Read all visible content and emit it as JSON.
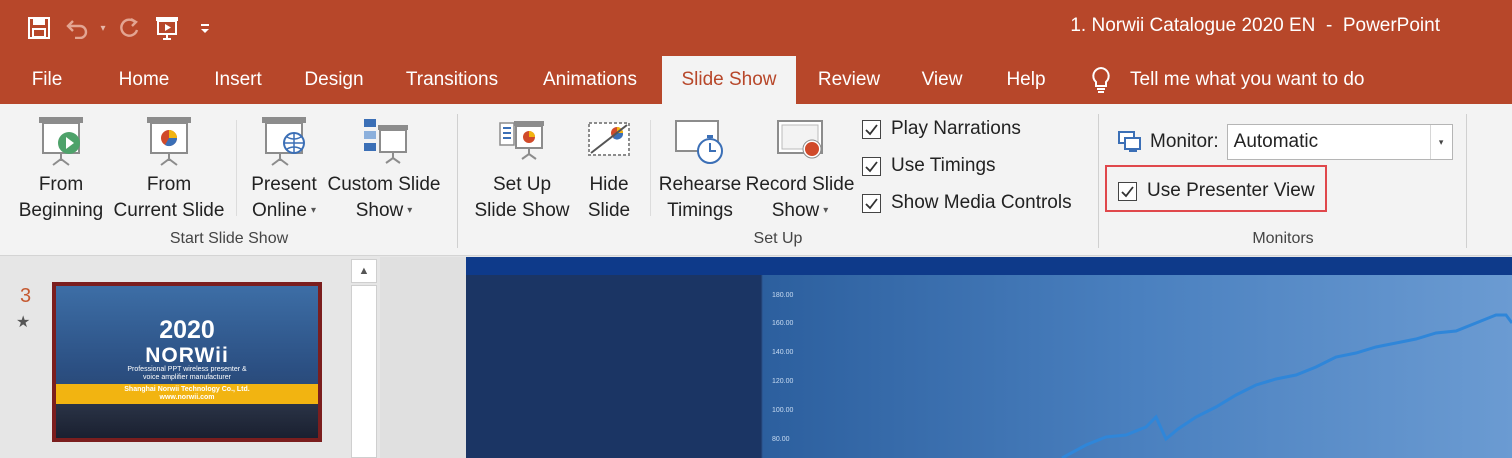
{
  "window": {
    "title": "1. Norwii Catalogue 2020 EN  -  PowerPoint"
  },
  "quick_access": {
    "icons": [
      "save-icon",
      "undo-icon",
      "redo-icon",
      "start-from-beginning-icon",
      "customize-qat-icon"
    ]
  },
  "tabs": [
    {
      "label": "File"
    },
    {
      "label": "Home"
    },
    {
      "label": "Insert"
    },
    {
      "label": "Design"
    },
    {
      "label": "Transitions"
    },
    {
      "label": "Animations"
    },
    {
      "label": "Slide Show",
      "active": true
    },
    {
      "label": "Review"
    },
    {
      "label": "View"
    },
    {
      "label": "Help"
    }
  ],
  "tell_me": {
    "label": "Tell me what you want to do"
  },
  "ribbon": {
    "start_slide_show": {
      "group_label": "Start Slide Show",
      "from_beginning": {
        "line1": "From",
        "line2": "Beginning"
      },
      "from_current": {
        "line1": "From",
        "line2": "Current Slide"
      },
      "present_online": {
        "line1": "Present",
        "line2": "Online"
      },
      "custom_slide_show": {
        "line1": "Custom Slide",
        "line2": "Show"
      }
    },
    "set_up": {
      "group_label": "Set Up",
      "set_up_slide_show": {
        "line1": "Set Up",
        "line2": "Slide Show"
      },
      "hide_slide": {
        "line1": "Hide",
        "line2": "Slide"
      },
      "rehearse_timings": {
        "line1": "Rehearse",
        "line2": "Timings"
      },
      "record_slide_show": {
        "line1": "Record Slide",
        "line2": "Show"
      },
      "play_narrations": {
        "label": "Play Narrations",
        "checked": true
      },
      "use_timings": {
        "label": "Use Timings",
        "checked": true
      },
      "show_media_controls": {
        "label": "Show Media Controls",
        "checked": true
      }
    },
    "monitors": {
      "group_label": "Monitors",
      "monitor_label": "Monitor:",
      "monitor_value": "Automatic",
      "use_presenter_view": {
        "label": "Use Presenter View",
        "checked": true
      }
    }
  },
  "thumbnails": {
    "slide_number": "3",
    "star_glyph": "★",
    "slide": {
      "year": "2020",
      "brand": "NORWii",
      "subtitle_line1": "Professional PPT wireless presenter &",
      "subtitle_line2": "voice amplifier manufacturer",
      "company": "Shanghai Norwii Technology Co., Ltd.",
      "url": "www.norwii.com"
    }
  },
  "main_slide": {
    "axis_ticks": [
      "180.00",
      "160.00",
      "140.00",
      "120.00",
      "100.00",
      "80.00"
    ]
  },
  "colors": {
    "accent": "#b7472a",
    "highlight_box": "#e0474b",
    "ribbon_bg": "#f3f3f3",
    "thumb_border": "#7b1e1e"
  }
}
